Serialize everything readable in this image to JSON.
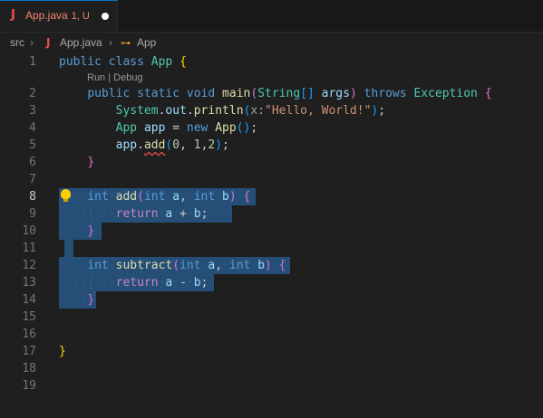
{
  "tab": {
    "icon": "java-icon",
    "letter": "J",
    "name": "App.java",
    "badge": "1, U",
    "dirty": true
  },
  "breadcrumb": {
    "folder": "src",
    "file": "App.java",
    "symbol": "App",
    "symbol_icon": "class-icon"
  },
  "codelens": "Run | Debug",
  "line_numbers": [
    "1",
    "2",
    "3",
    "4",
    "5",
    "6",
    "7",
    "8",
    "9",
    "10",
    "11",
    "12",
    "13",
    "14",
    "15",
    "16",
    "17",
    "18",
    "19"
  ],
  "active_line": "8",
  "code": {
    "l1": {
      "public": "public",
      "class": "class",
      "name": "App",
      "brace": "{"
    },
    "l2": {
      "public": "public",
      "static": "static",
      "void": "void",
      "main": "main",
      "lp": "(",
      "type": "String",
      "arr": "[]",
      "args": "args",
      "rp": ")",
      "throws": "throws",
      "exc": "Exception",
      "brace": "{"
    },
    "l3": {
      "sys": "System",
      "dot1": ".",
      "out": "out",
      "dot2": ".",
      "println": "println",
      "lp": "(",
      "hint": "x:",
      "str": "\"Hello, World!\"",
      "rp": ")",
      "semi": ";"
    },
    "l4": {
      "type": "App",
      "var": "app",
      "eq": "=",
      "new": "new",
      "ctor": "App",
      "lp": "(",
      "rp": ")",
      "semi": ";"
    },
    "l5": {
      "var": "app",
      "dot": ".",
      "add": "add",
      "lp": "(",
      "n0": "0",
      "c1": ",",
      "n1": "1",
      "c2": ",",
      "n2": "2",
      "rp": ")",
      "semi": ";"
    },
    "l6": {
      "brace": "}"
    },
    "l8": {
      "int": "int",
      "add": "add",
      "lp": "(",
      "int2": "int",
      "a": "a",
      "comma": ",",
      "int3": "int",
      "b": "b",
      "rp": ")",
      "brace": "{"
    },
    "l9": {
      "return": "return",
      "a": "a",
      "op": "+",
      "b": "b",
      "semi": ";"
    },
    "l10": {
      "brace": "}"
    },
    "l12": {
      "int": "int",
      "sub": "subtract",
      "lp": "(",
      "int2": "int",
      "a": "a",
      "comma": ",",
      "int3": "int",
      "b": "b",
      "rp": ")",
      "brace": "{"
    },
    "l13": {
      "return": "return",
      "a": "a",
      "op": "-",
      "b": "b",
      "semi": ";"
    },
    "l14": {
      "brace": "}"
    },
    "l17": {
      "brace": "}"
    }
  },
  "colors": {
    "keyword": "#569cd6",
    "type": "#4ec9b0",
    "function": "#dcdcaa",
    "variable": "#9cdcfe",
    "string": "#ce9178",
    "number": "#b5cea8",
    "selection": "#264f78",
    "error": "#f14c4c"
  }
}
